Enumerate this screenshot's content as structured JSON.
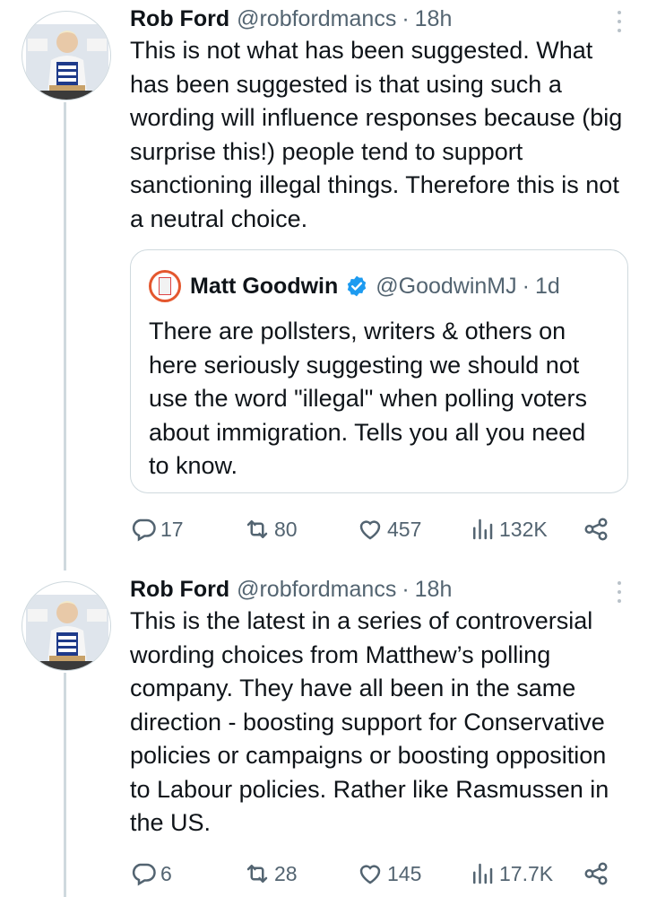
{
  "tweets": [
    {
      "author_name": "Rob Ford",
      "handle": "@robfordmancs",
      "separator": "·",
      "time": "18h",
      "avatar_icon": "politician-avatar-get-brexit-done",
      "text": "This is not what has been suggested. What has been suggested is that using such a wording will influence responses because (big surprise this!) people tend to support sanctioning illegal things. Therefore this is not a neutral choice.",
      "quote": {
        "author_name": "Matt Goodwin",
        "verified_icon": "verified-badge-icon",
        "handle": "@GoodwinMJ",
        "separator": "·",
        "time": "1d",
        "text": "There are pollsters, writers & others on here seriously suggesting we should not use the word \"illegal\" when polling voters about immigration. Tells you all you need to know."
      },
      "stats": {
        "replies": "17",
        "retweets": "80",
        "likes": "457",
        "views": "132K"
      }
    },
    {
      "author_name": "Rob Ford",
      "handle": "@robfordmancs",
      "separator": "·",
      "time": "18h",
      "avatar_icon": "politician-avatar-get-brexit-done",
      "text": "This is the latest in a series of controversial wording choices from Matthew’s polling company. They have all been in the same direction - boosting support for Conservative policies or campaigns or boosting opposition to Labour policies. Rather like Rasmussen in the US.",
      "stats": {
        "replies": "6",
        "retweets": "28",
        "likes": "145",
        "views": "17.7K"
      }
    }
  ],
  "colors": {
    "text": "#0f1419",
    "secondary": "#536471",
    "border": "#cfd9de",
    "verified": "#1d9bf0"
  }
}
